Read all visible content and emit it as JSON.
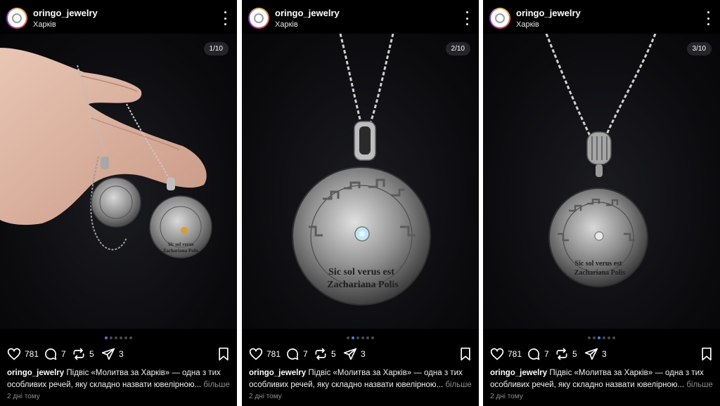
{
  "posts": [
    {
      "username": "oringo_jewelry",
      "location": "Харків",
      "counter": "1/10",
      "active_dot": 0,
      "likes": "781",
      "comments": "7",
      "reposts": "5",
      "shares": "3",
      "caption_user": "oringo_jewelry",
      "caption_text": "Підвіс «Молитва за Харків» — одна з тих особливих речей, яку складно назвати ювелірною...",
      "more_label": "більше",
      "time": "2 дні тому",
      "pendant_text": [
        "Sic sol verus",
        "Zachariana Polis"
      ]
    },
    {
      "username": "oringo_jewelry",
      "location": "Харків",
      "counter": "2/10",
      "active_dot": 1,
      "likes": "781",
      "comments": "7",
      "reposts": "5",
      "shares": "3",
      "caption_user": "oringo_jewelry",
      "caption_text": "Підвіс «Молитва за Харків» — одна з тих особливих речей, яку складно назвати ювелірною...",
      "more_label": "більше",
      "time": "2 дні тому",
      "pendant_text": [
        "Sic sol verus est",
        "Zachariana Polis"
      ]
    },
    {
      "username": "oringo_jewelry",
      "location": "Харків",
      "counter": "3/10",
      "active_dot": 2,
      "likes": "781",
      "comments": "7",
      "reposts": "5",
      "shares": "3",
      "caption_user": "oringo_jewelry",
      "caption_text": "Підвіс «Молитва за Харків» — одна з тих особливих речей, яку складно назвати ювелірною...",
      "more_label": "більше",
      "time": "2 дні тому",
      "pendant_text": [
        "Sic sol verus est",
        "Zachariana Polis"
      ]
    }
  ],
  "icons": {
    "like": "heart-icon",
    "comment": "comment-icon",
    "repost": "repost-icon",
    "share": "share-icon",
    "save": "bookmark-icon",
    "menu": "more-vertical-icon"
  },
  "colors": {
    "background": "#000000",
    "active_dot": "#3b82f6",
    "muted_text": "#8e8e8e"
  }
}
